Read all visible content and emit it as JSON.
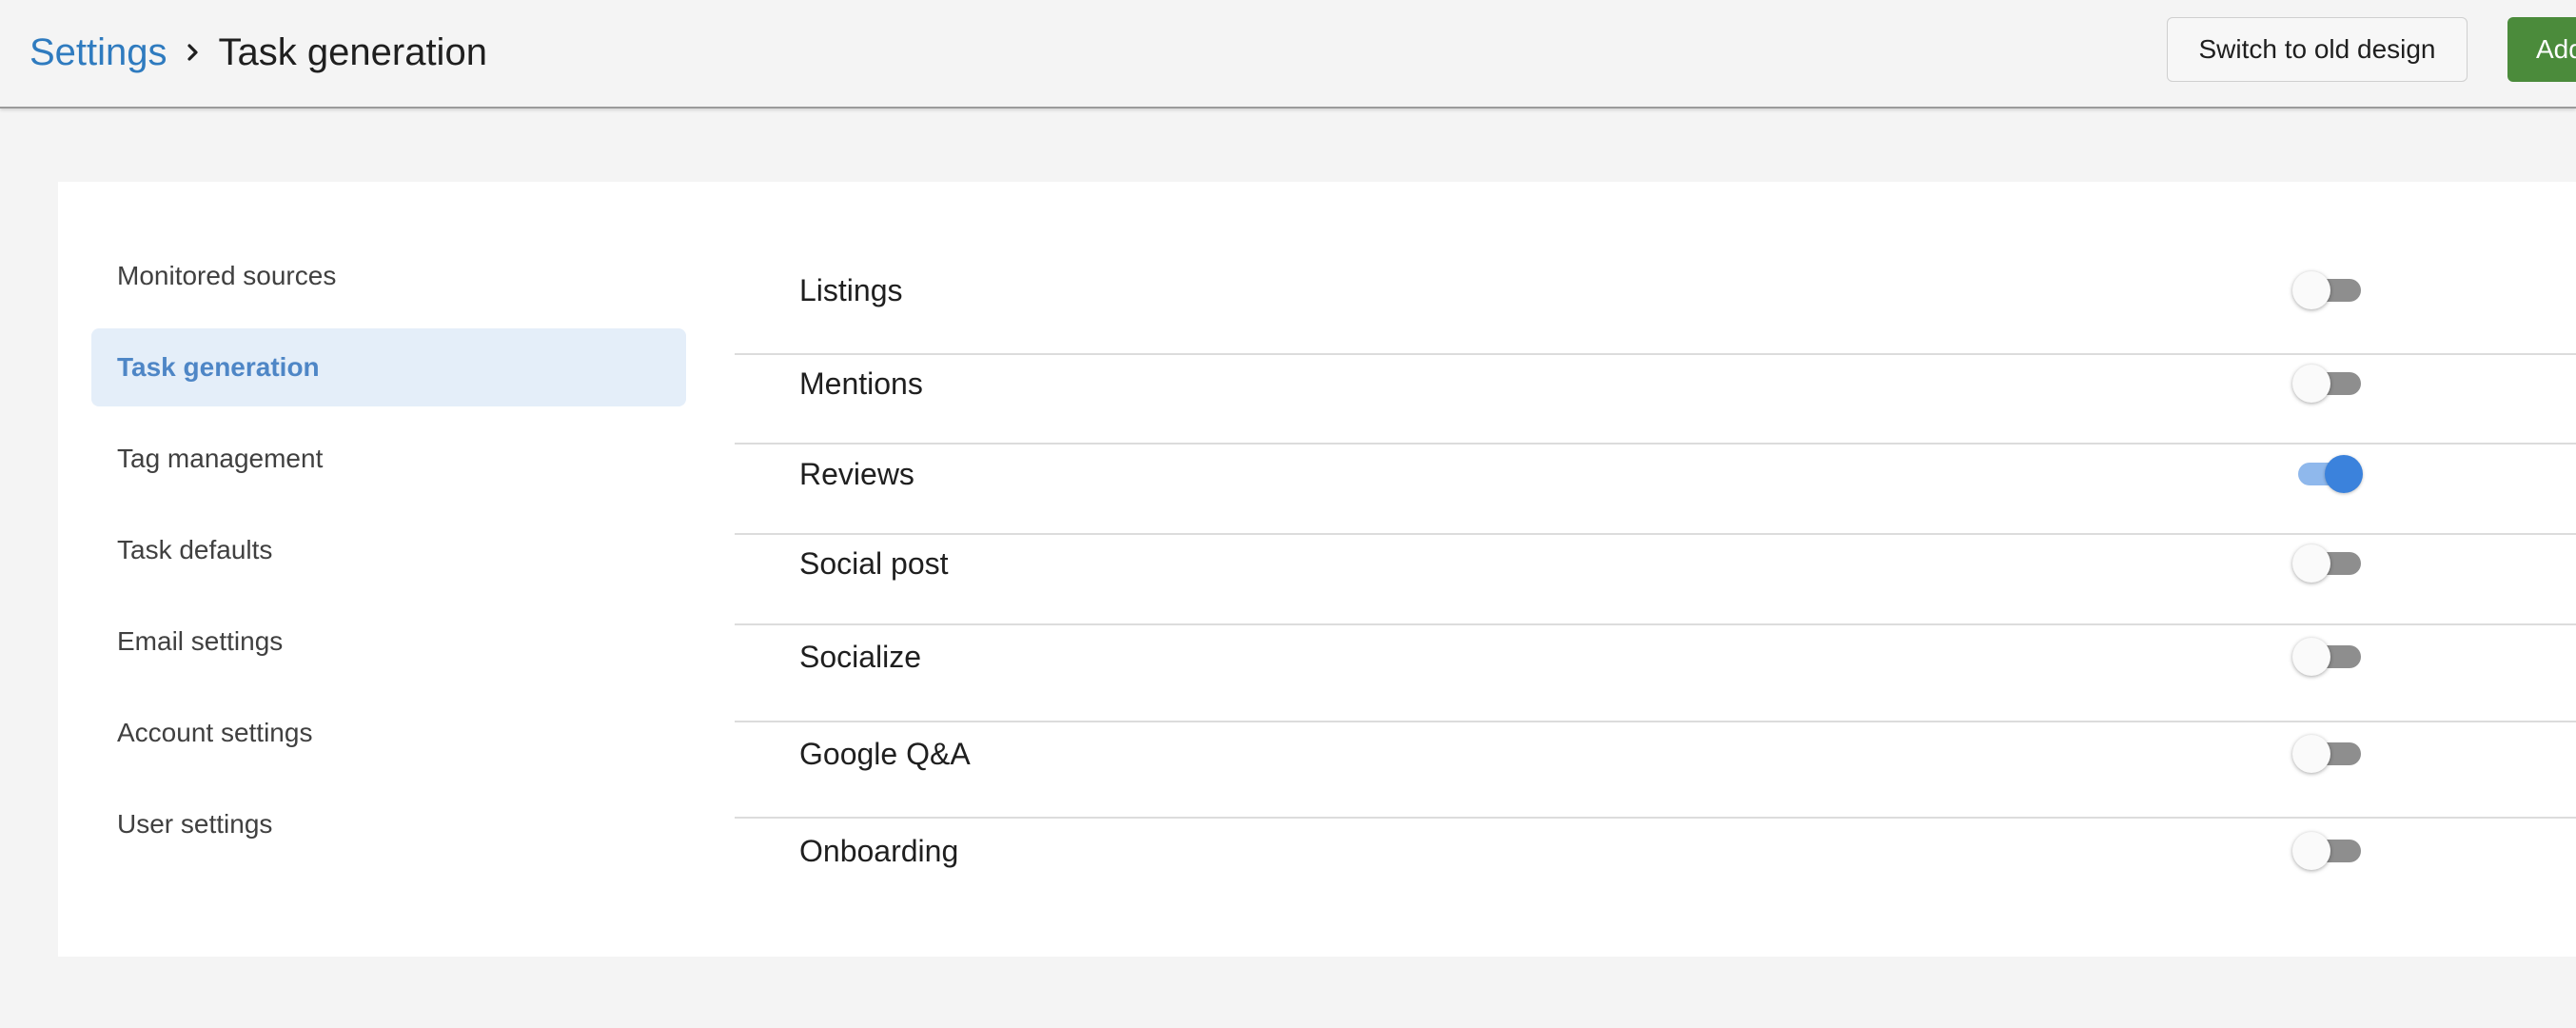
{
  "header": {
    "breadcrumb_root": "Settings",
    "breadcrumb_separator_icon": "chevron-right-icon",
    "breadcrumb_current": "Task generation",
    "switch_design_label": "Switch to old design",
    "add_label": "Add"
  },
  "sidebar": {
    "items": [
      {
        "label": "Monitored sources",
        "active": false
      },
      {
        "label": "Task generation",
        "active": true
      },
      {
        "label": "Tag management",
        "active": false
      },
      {
        "label": "Task defaults",
        "active": false
      },
      {
        "label": "Email settings",
        "active": false
      },
      {
        "label": "Account settings",
        "active": false
      },
      {
        "label": "User settings",
        "active": false
      }
    ]
  },
  "task_types": [
    {
      "label": "Listings",
      "enabled": false,
      "expandable": false
    },
    {
      "label": "Mentions",
      "enabled": false,
      "expandable": true
    },
    {
      "label": "Reviews",
      "enabled": true,
      "expandable": true
    },
    {
      "label": "Social post",
      "enabled": false,
      "expandable": true
    },
    {
      "label": "Socialize",
      "enabled": false,
      "expandable": false
    },
    {
      "label": "Google Q&A",
      "enabled": false,
      "expandable": false
    },
    {
      "label": "Onboarding",
      "enabled": false,
      "expandable": false
    }
  ],
  "colors": {
    "link": "#2f7bbf",
    "active_nav_bg": "#e4eef9",
    "active_nav_text": "#4e86c6",
    "toggle_on": "#3b82dc",
    "add_button": "#4b8b3b"
  }
}
